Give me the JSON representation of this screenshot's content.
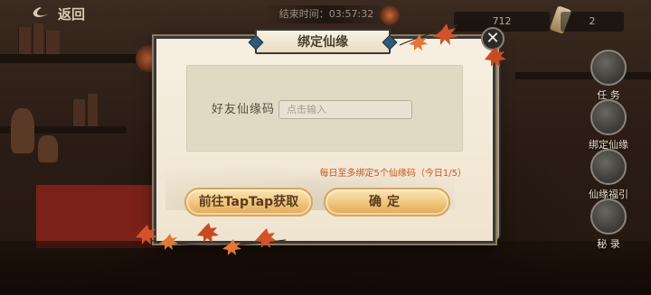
{
  "topbar": {
    "back_label": "返回",
    "timer_text": "结束时间：03:57:32",
    "resource_1": "712",
    "resource_2": "2"
  },
  "side_menu": [
    {
      "label": "任 务",
      "icon": "task-scroll-icon"
    },
    {
      "label": "绑定仙缘",
      "icon": "bind-fate-icon"
    },
    {
      "label": "仙缘福引",
      "icon": "fortune-draw-icon"
    },
    {
      "label": "秘 录",
      "icon": "secret-record-icon"
    }
  ],
  "dialog": {
    "title": "绑定仙缘",
    "close_label": "✕",
    "field_label": "好友仙缘码",
    "input_placeholder": "点击输入",
    "input_value": "",
    "limit_text": "每日至多绑定5个仙缘码（今日1/5）",
    "taptap_button": "前往TapTap获取",
    "confirm_button": "确定"
  },
  "colors": {
    "accent_orange": "#c9561e",
    "button_gold": "#efc57c",
    "panel_paper": "#f6efe0",
    "frame_dark": "#3c3834"
  }
}
